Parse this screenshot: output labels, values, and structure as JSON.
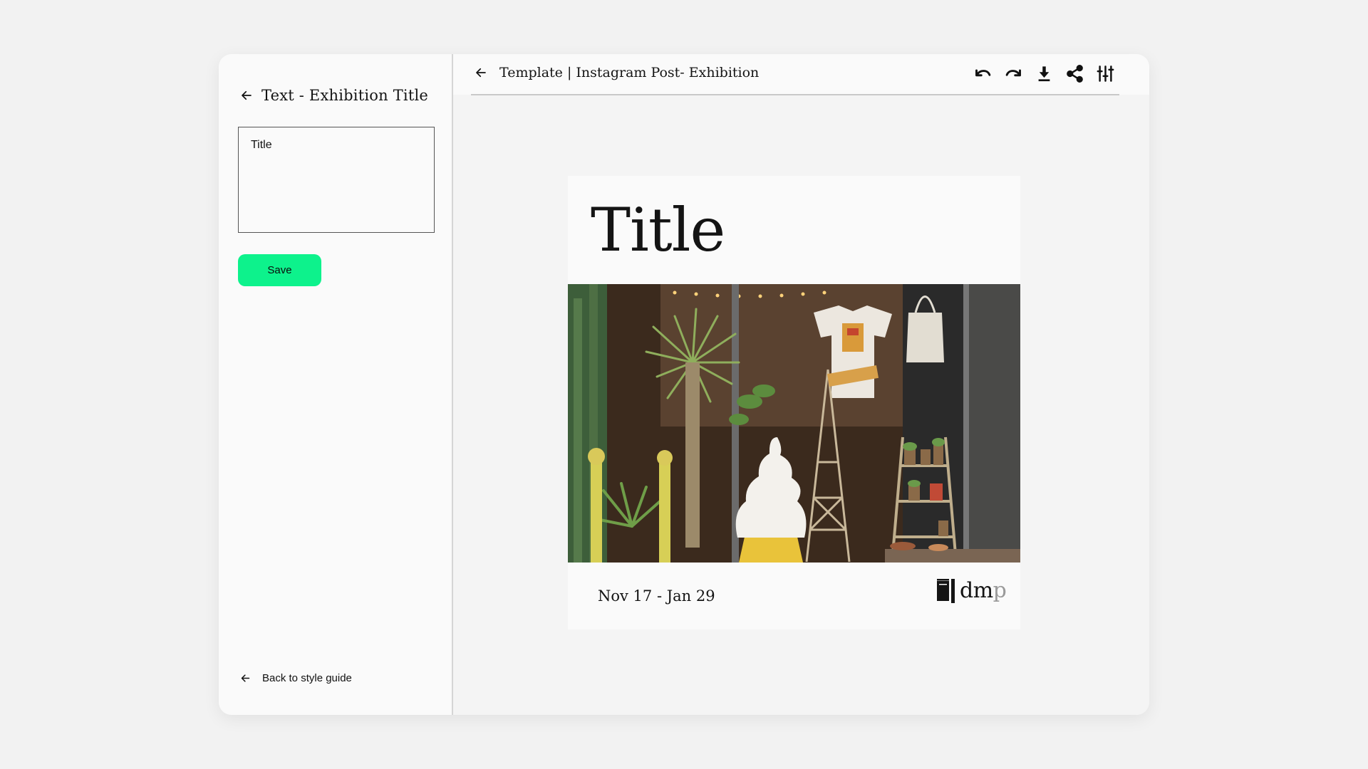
{
  "sidebar": {
    "header_title": "Text - Exhibition Title",
    "title_field_value": "Title",
    "save_label": "Save",
    "back_link": "Back to style guide"
  },
  "topbar": {
    "title": "Template | Instagram Post- Exhibition",
    "actions": [
      {
        "name": "undo",
        "icon": "undo-icon"
      },
      {
        "name": "redo",
        "icon": "redo-icon"
      },
      {
        "name": "download",
        "icon": "download-icon"
      },
      {
        "name": "share",
        "icon": "share-icon"
      },
      {
        "name": "adjust",
        "icon": "sliders-icon"
      }
    ]
  },
  "poster": {
    "title": "Title",
    "date": "Nov 17 - Jan 29",
    "logo_main": "dm",
    "logo_accent": "p",
    "photo": "storefront-with-plants-and-ice-cream-cone-statue"
  },
  "colors": {
    "accent": "#0df28c",
    "page_bg": "#f2f2f2",
    "panel_bg": "#fafafa",
    "text": "#141414"
  }
}
